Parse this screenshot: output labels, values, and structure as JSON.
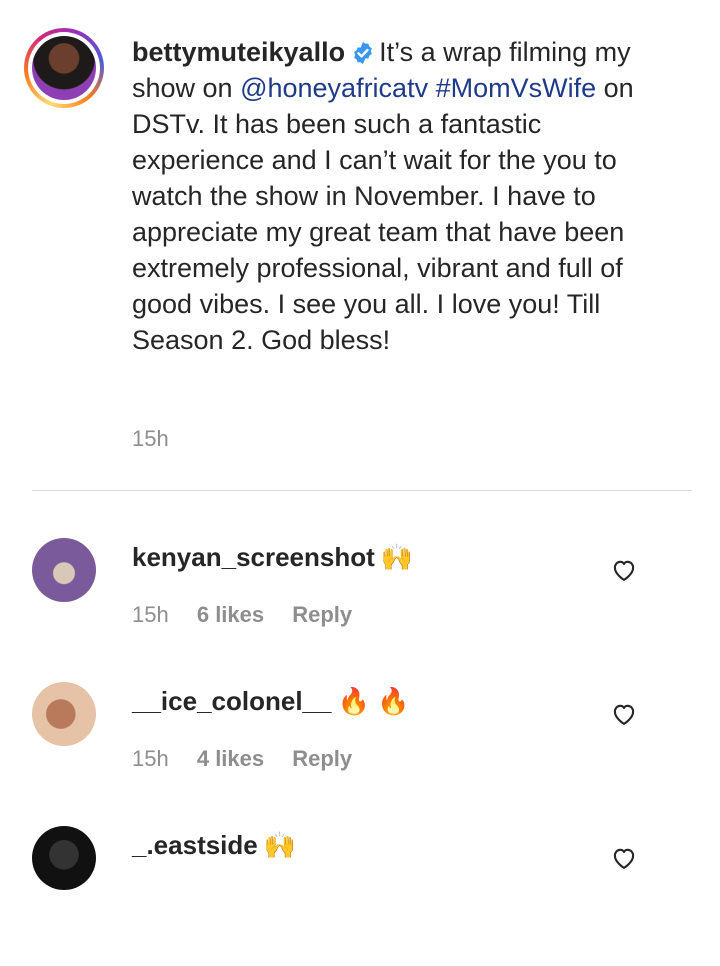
{
  "caption": {
    "username": "bettymuteikyallo",
    "text_before": "It’s a wrap filming my show on ",
    "mention": "@honeyafricatv",
    "hashtag": "#MomVsWife",
    "text_after": " on DSTv. It has been such a fantastic experience and I can’t wait for the you to watch the show in November. I have to appreciate my great team that have been extremely professional, vibrant and full of good vibes. I see you all. I love you! Till Season 2. God bless!",
    "time": "15h"
  },
  "comments": [
    {
      "username": "kenyan_screenshot",
      "emoji": "🙌",
      "time": "15h",
      "likes": "6 likes",
      "reply": "Reply"
    },
    {
      "username": "__ice_colonel__",
      "emoji": "🔥 🔥",
      "time": "15h",
      "likes": "4 likes",
      "reply": "Reply"
    },
    {
      "username": "_.eastside",
      "emoji": "🙌",
      "time": "",
      "likes": "",
      "reply": ""
    }
  ],
  "colors": {
    "link": "#1e3a8a",
    "verified": "#3897f0",
    "muted": "#8e8e8e"
  },
  "icons": [
    "verified-badge-icon",
    "heart-icon"
  ]
}
